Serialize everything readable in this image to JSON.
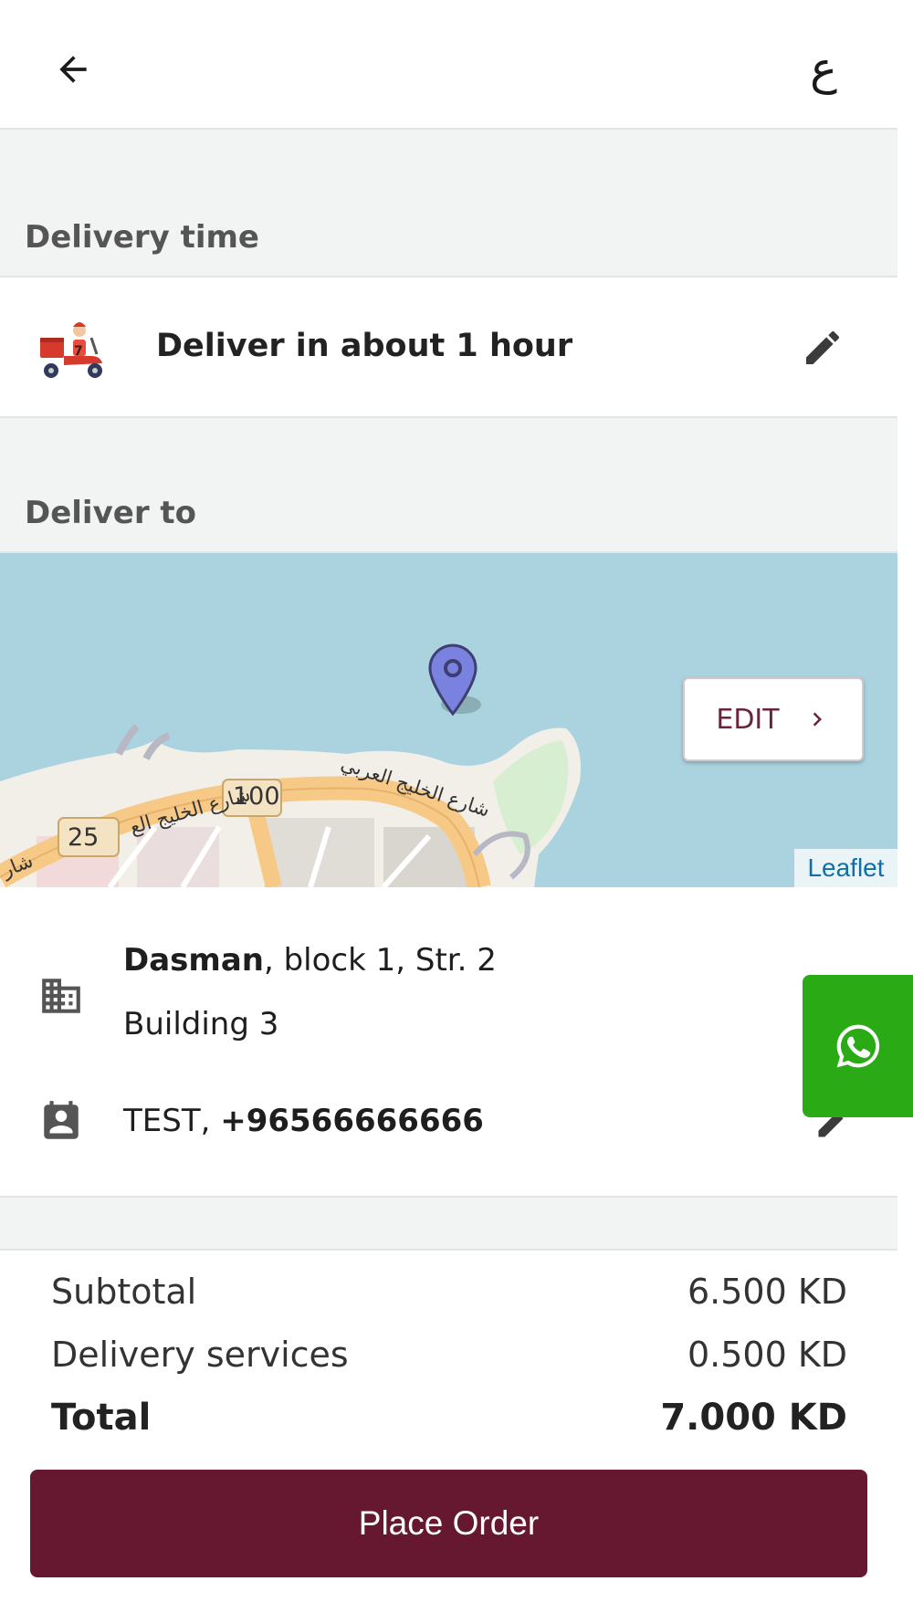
{
  "header": {
    "back_icon": "arrow-left-icon",
    "language_label": "ع"
  },
  "delivery_time": {
    "section_label": "Delivery time",
    "text": "Deliver in about 1 hour",
    "icon": "delivery-scooter-icon",
    "edit_icon": "pencil-icon"
  },
  "deliver_to": {
    "section_label": "Deliver to",
    "map": {
      "edit_label": "EDIT",
      "attribution": "Leaflet",
      "road_labels": [
        "100",
        "25",
        "شارع الخليج العربي",
        "شارع الخليج الع",
        "شار"
      ]
    },
    "address": {
      "area": "Dasman",
      "line1_rest": ", block 1, Str. 2",
      "line2": "Building 3"
    },
    "contact": {
      "name_prefix": "TEST, ",
      "phone": "+96566666666"
    }
  },
  "summary": {
    "subtotal_label": "Subtotal",
    "subtotal_value": "6.500 KD",
    "delivery_label": "Delivery services",
    "delivery_value": "0.500 KD",
    "total_label": "Total",
    "total_value": "7.000 KD"
  },
  "actions": {
    "place_order_label": "Place Order"
  },
  "colors": {
    "primary": "#661831",
    "whatsapp": "#2aaa14",
    "section_bg": "#f2f4f4",
    "sea": "#aad3df"
  }
}
